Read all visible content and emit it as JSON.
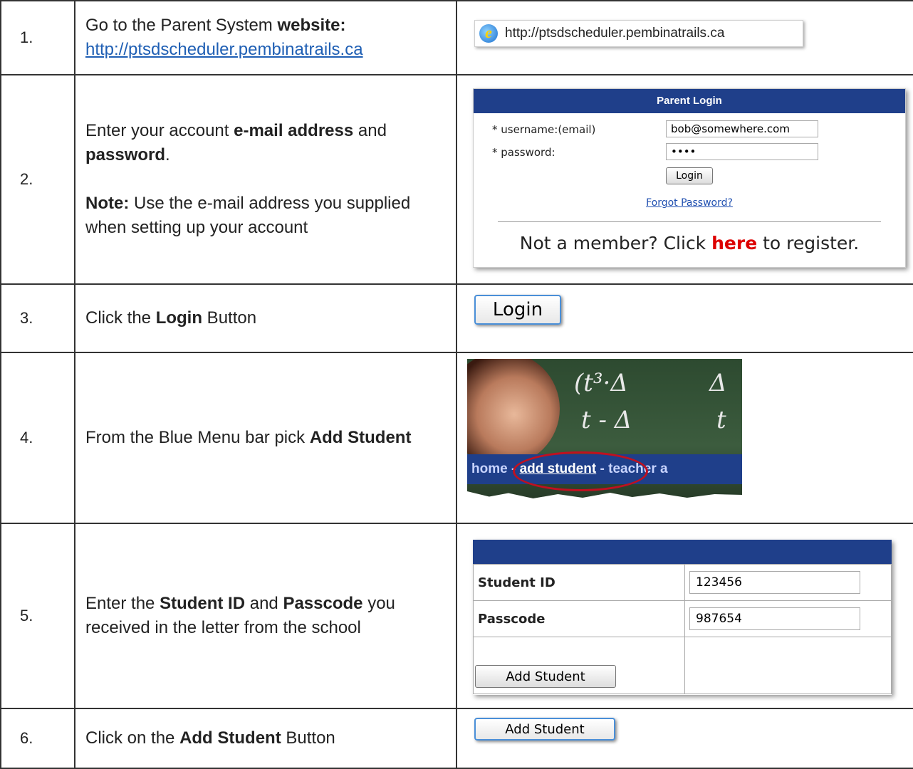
{
  "steps": [
    {
      "num": "1.",
      "text_pre": "Go to the Parent System ",
      "text_bold": "website:",
      "link": "http://ptsdscheduler.pembinatrails.ca",
      "url_bar_text": "http://ptsdscheduler.pembinatrails.ca"
    },
    {
      "num": "2.",
      "text_pre": "Enter your account ",
      "bold1": "e-mail address",
      "mid": " and ",
      "bold2": "password",
      "end": ".",
      "note_label": "Note:",
      "note_text": " Use the e-mail address you supplied when setting up your account",
      "login": {
        "header": "Parent Login",
        "username_label": "* username:(email)",
        "username_value": "bob@somewhere.com",
        "password_label": "* password:",
        "password_value": "••••",
        "button": "Login",
        "forgot": "Forgot Password?",
        "register_pre": "Not a member? Click ",
        "register_link": "here",
        "register_post": " to register."
      }
    },
    {
      "num": "3.",
      "text_pre": "Click the ",
      "bold": "Login",
      "text_post": " Button",
      "button": "Login"
    },
    {
      "num": "4.",
      "text_pre": "From the Blue Menu bar pick ",
      "bold": "Add Student",
      "menu_home": "home",
      "menu_sep": " - ",
      "menu_add": "add student",
      "menu_next": " - teacher a",
      "chalk1": "(t³·Δ",
      "chalk2": "t - Δ",
      "chalk3": "Δ",
      "chalk4": "t"
    },
    {
      "num": "5.",
      "text_pre": "Enter the ",
      "bold1": "Student ID",
      "mid": " and ",
      "bold2": "Passcode",
      "text_post": " you received in the letter from the school",
      "form": {
        "student_id_label": "Student ID",
        "student_id_value": "123456",
        "passcode_label": "Passcode",
        "passcode_value": "987654",
        "button": "Add Student"
      }
    },
    {
      "num": "6.",
      "text_pre": "Click on the ",
      "bold": "Add Student",
      "text_post": " Button",
      "button": "Add Student"
    }
  ]
}
